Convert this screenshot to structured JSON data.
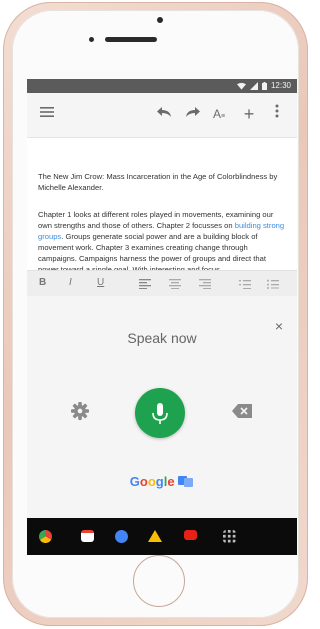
{
  "status_bar": {
    "time": "12:30"
  },
  "toolbar": {
    "menu_icon": "menu-icon",
    "undo_icon": "undo-icon",
    "redo_icon": "redo-icon",
    "text_format_icon": "text-format-icon",
    "add_icon": "plus-icon",
    "more_icon": "more-vert-icon"
  },
  "document": {
    "paragraph1": "The New Jim Crow: Mass Incarceration in the Age of Colorblindness by Michelle Alexander.",
    "paragraph2_part1": "Chapter 1 looks at different roles played in movements, examining our own strengths and those of others. Chapter 2 focusses on ",
    "paragraph2_link": "building strong groups",
    "paragraph2_part2": ". Groups generate social power and are a building block of movement work. Chapter 3 examines creating change through campaigns. Campaigns harness the power of groups and direct that power toward a single goal. With interesting and focus"
  },
  "format_bar": {
    "bold": "B",
    "italic": "I",
    "underline": "U"
  },
  "voice_input": {
    "prompt": "Speak now",
    "close_label": "×",
    "logo": [
      "G",
      "o",
      "o",
      "g",
      "l",
      "e"
    ],
    "logo_colors": [
      "#4285f4",
      "#ea4335",
      "#fbbc05",
      "#4285f4",
      "#34a853",
      "#ea4335"
    ],
    "mic_color": "#1fa24f"
  },
  "dock": {
    "apps": [
      "chrome-icon",
      "gmail-icon",
      "contacts-icon",
      "drive-icon",
      "youtube-icon",
      "apps-grid-icon"
    ]
  }
}
